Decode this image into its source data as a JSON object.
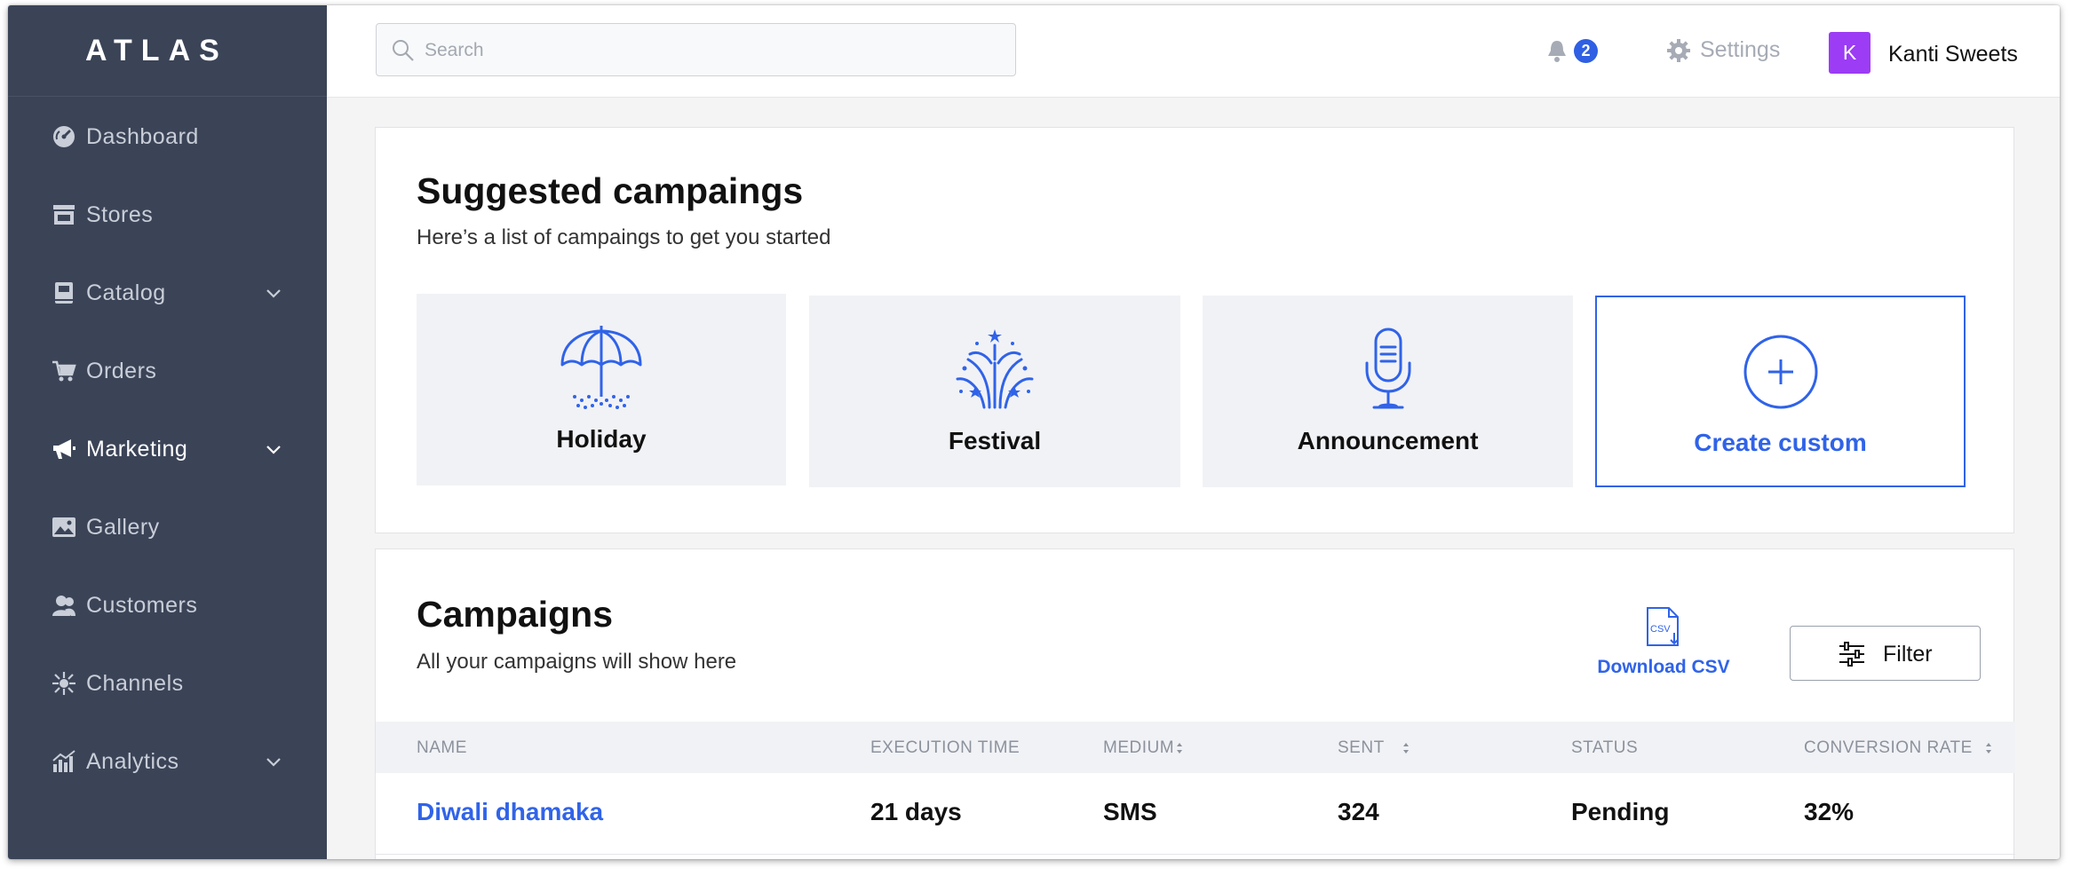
{
  "app": {
    "logo": "ATLAS"
  },
  "sidebar": {
    "items": [
      {
        "label": "Dashboard",
        "icon": "dashboard-icon",
        "has_chevron": false
      },
      {
        "label": "Stores",
        "icon": "store-icon",
        "has_chevron": false
      },
      {
        "label": "Catalog",
        "icon": "catalog-icon",
        "has_chevron": true
      },
      {
        "label": "Orders",
        "icon": "cart-icon",
        "has_chevron": false
      },
      {
        "label": "Marketing",
        "icon": "megaphone-icon",
        "has_chevron": true,
        "active": true
      },
      {
        "label": "Gallery",
        "icon": "gallery-icon",
        "has_chevron": false
      },
      {
        "label": "Customers",
        "icon": "customers-icon",
        "has_chevron": false
      },
      {
        "label": "Channels",
        "icon": "channels-icon",
        "has_chevron": false
      },
      {
        "label": "Analytics",
        "icon": "analytics-icon",
        "has_chevron": true
      }
    ]
  },
  "header": {
    "search_placeholder": "Search",
    "notifications_count": "2",
    "settings_label": "Settings",
    "avatar_initial": "K",
    "user_name": "Kanti Sweets"
  },
  "suggested": {
    "title": "Suggested campaings",
    "subtitle": "Here’s a list of campaings to get you started",
    "tiles": [
      {
        "label": "Holiday",
        "icon": "umbrella-icon"
      },
      {
        "label": "Festival",
        "icon": "fireworks-icon"
      },
      {
        "label": "Announcement",
        "icon": "microphone-icon"
      },
      {
        "label": "Create custom",
        "icon": "plus-circle-icon"
      }
    ]
  },
  "campaigns": {
    "title": "Campaigns",
    "subtitle": "All your campaigns will show here",
    "download_label": "Download CSV",
    "csv_icon_text": "CSV",
    "filter_label": "Filter",
    "columns": [
      "NAME",
      "EXECUTION TIME",
      "MEDIUM",
      "SENT",
      "STATUS",
      "CONVERSION RATE"
    ],
    "rows": [
      {
        "name": "Diwali dhamaka",
        "execution_time": "21 days",
        "medium": "SMS",
        "sent": "324",
        "status": "Pending",
        "conversion_rate": "32%"
      }
    ]
  },
  "colors": {
    "sidebar_bg": "#3b4457",
    "accent": "#3063e8",
    "avatar_bg": "#9c3cf5",
    "tile_bg": "#f1f2f6"
  }
}
